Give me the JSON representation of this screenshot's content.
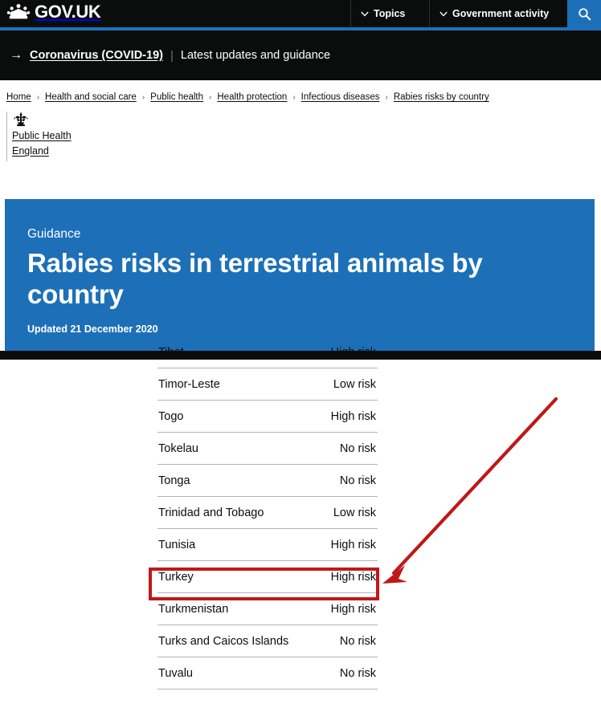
{
  "header": {
    "logo_text": "GOV.UK",
    "crown_icon": "crown-icon",
    "nav": [
      {
        "label": "Topics",
        "icon": "chevron-down-icon"
      },
      {
        "label": "Government activity",
        "icon": "chevron-down-icon"
      }
    ],
    "search_icon": "search-icon"
  },
  "covid_banner": {
    "arrow": "→",
    "link_label": "Coronavirus (COVID-19)",
    "separator": "|",
    "subtitle": "Latest updates and guidance"
  },
  "breadcrumb": {
    "separator": "›",
    "items": [
      "Home",
      "Health and social care",
      "Public health",
      "Health protection",
      "Infectious diseases",
      "Rabies risks by country"
    ]
  },
  "organisation": {
    "crest_icon": "royal-crest-icon",
    "line1": "Public Health",
    "line2": "England"
  },
  "hero": {
    "eyebrow": "Guidance",
    "title": "Rabies risks in terrestrial animals by country",
    "updated": "Updated 21 December 2020",
    "background_color": "#1d70b8"
  },
  "table": {
    "rows": [
      {
        "country": "Tibet",
        "risk": "High risk",
        "partial": true
      },
      {
        "country": "Timor-Leste",
        "risk": "Low risk",
        "partial": false
      },
      {
        "country": "Togo",
        "risk": "High risk",
        "partial": false
      },
      {
        "country": "Tokelau",
        "risk": "No risk",
        "partial": false
      },
      {
        "country": "Tonga",
        "risk": "No risk",
        "partial": false
      },
      {
        "country": "Trinidad and Tobago",
        "risk": "Low risk",
        "partial": false
      },
      {
        "country": "Tunisia",
        "risk": "High risk",
        "partial": false
      },
      {
        "country": "Turkey",
        "risk": "High risk",
        "partial": false
      },
      {
        "country": "Turkmenistan",
        "risk": "High risk",
        "partial": false
      },
      {
        "country": "Turks and Caicos Islands",
        "risk": "No risk",
        "partial": false
      },
      {
        "country": "Tuvalu",
        "risk": "No risk",
        "partial": false
      }
    ]
  },
  "annotation": {
    "highlight_color": "#c01818",
    "arrow_color": "#c01818",
    "highlighted_row": "Turkey"
  }
}
